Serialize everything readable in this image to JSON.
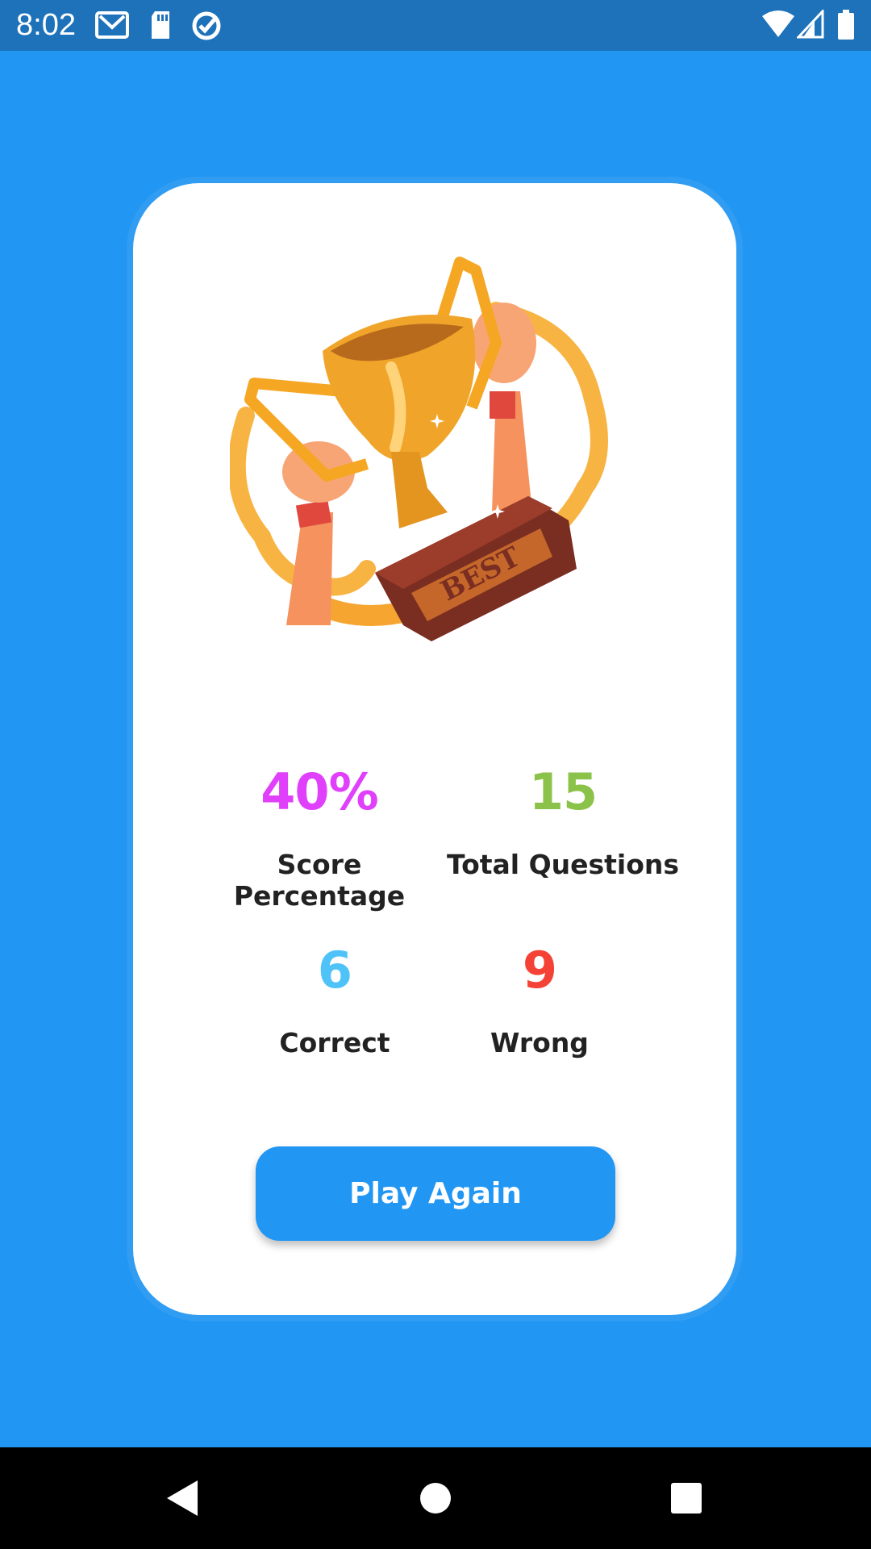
{
  "status_bar": {
    "time": "8:02",
    "icons_left": [
      "gmail-icon",
      "sd-card-icon",
      "sync-icon"
    ],
    "icons_right": [
      "wifi-icon",
      "signal-icon",
      "battery-icon"
    ]
  },
  "trophy": {
    "plaque_text": "BEST",
    "icon": "trophy-illustration"
  },
  "stats": {
    "score_percentage": {
      "value": "40%",
      "label": "Score Percentage",
      "color": "#E040FB"
    },
    "total_questions": {
      "value": "15",
      "label": "Total Questions",
      "color": "#8BC34A"
    },
    "correct": {
      "value": "6",
      "label": "Correct",
      "color": "#4FC3F7"
    },
    "wrong": {
      "value": "9",
      "label": "Wrong",
      "color": "#F44336"
    }
  },
  "play_again": {
    "label": "Play Again"
  },
  "colors": {
    "background": "#2196F3",
    "status_bar": "#1E72BA",
    "card": "#FFFFFF",
    "button": "#2196F3"
  },
  "nav_bar": {
    "buttons": [
      "back-icon",
      "home-icon",
      "recents-icon"
    ]
  }
}
